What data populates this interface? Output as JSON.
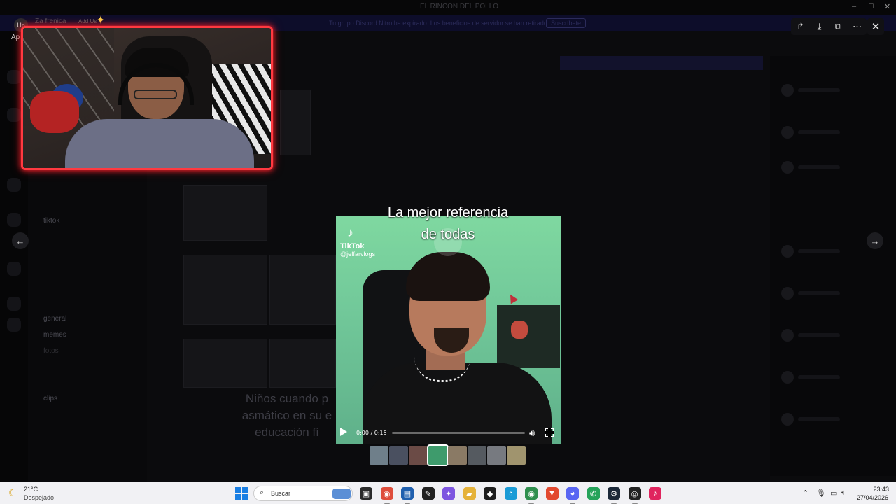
{
  "window": {
    "title": "EL RINCON DEL POLLO",
    "controls": {
      "minimize": "–",
      "maximize": "□",
      "close": "✕"
    }
  },
  "banner": {
    "text": "Tu grupo Discord Nitro ha expirado. Los beneficios de servidor se han retirado.",
    "button": "Suscríbete"
  },
  "stream_overlay": {
    "name": "Za frenica",
    "sub": "Add Us",
    "avatar_label": "Un",
    "side_text": "Ap"
  },
  "background_channels": [
    "tiktok",
    "general",
    "memes",
    "fotos",
    "clips"
  ],
  "background_caption": "Niños cuando p asmático en su e educación fí",
  "media_viewer": {
    "caption_line1": "La mejor referencia",
    "caption_line2": "de todas",
    "tiktok_brand": "TikTok",
    "tiktok_user": "@jeffarvlogs",
    "time": "0:00 / 0:15",
    "progress": 0.0,
    "toolbar": {
      "forward_icon": "↱",
      "download_icon": "⤓",
      "open_icon": "⧉",
      "more_icon": "⋯"
    },
    "close_icon": "✕",
    "prev_icon": "←",
    "next_icon": "→"
  },
  "thumbnails": [
    {
      "color": "#6f7f8a"
    },
    {
      "color": "#4a5060"
    },
    {
      "color": "#6b4b46"
    },
    {
      "color": "#3e9b6c"
    },
    {
      "color": "#8a7a65"
    },
    {
      "color": "#555a60"
    },
    {
      "color": "#777a80"
    },
    {
      "color": "#a0946e"
    }
  ],
  "taskbar": {
    "weather_temp": "21°C",
    "weather_desc": "Despejado",
    "search_placeholder": "Buscar",
    "time": "23:43",
    "date": "27/04/2026",
    "apps": [
      {
        "name": "taskview",
        "glyph": "▣",
        "color": "#2b2b2b"
      },
      {
        "name": "chrome",
        "glyph": "◉",
        "color": "#de4d3b"
      },
      {
        "name": "explorer-app",
        "glyph": "▤",
        "color": "#1f5fae"
      },
      {
        "name": "notes",
        "glyph": "✎",
        "color": "#222"
      },
      {
        "name": "copilot",
        "glyph": "✦",
        "color": "#7d55e0"
      },
      {
        "name": "files",
        "glyph": "▰",
        "color": "#e5b23a"
      },
      {
        "name": "binance",
        "glyph": "◆",
        "color": "#1e1e1e"
      },
      {
        "name": "edge",
        "glyph": "◔",
        "color": "#1a9bd6"
      },
      {
        "name": "chrome-alt",
        "glyph": "◉",
        "color": "#2f8f4e"
      },
      {
        "name": "brave",
        "glyph": "▼",
        "color": "#e2492f"
      },
      {
        "name": "discord",
        "glyph": "◕",
        "color": "#5865f2"
      },
      {
        "name": "whatsapp",
        "glyph": "✆",
        "color": "#25a35a"
      },
      {
        "name": "steam",
        "glyph": "⚙",
        "color": "#1b2838"
      },
      {
        "name": "obs",
        "glyph": "◎",
        "color": "#222"
      },
      {
        "name": "tiktok",
        "glyph": "♪",
        "color": "#e0245e"
      }
    ]
  }
}
